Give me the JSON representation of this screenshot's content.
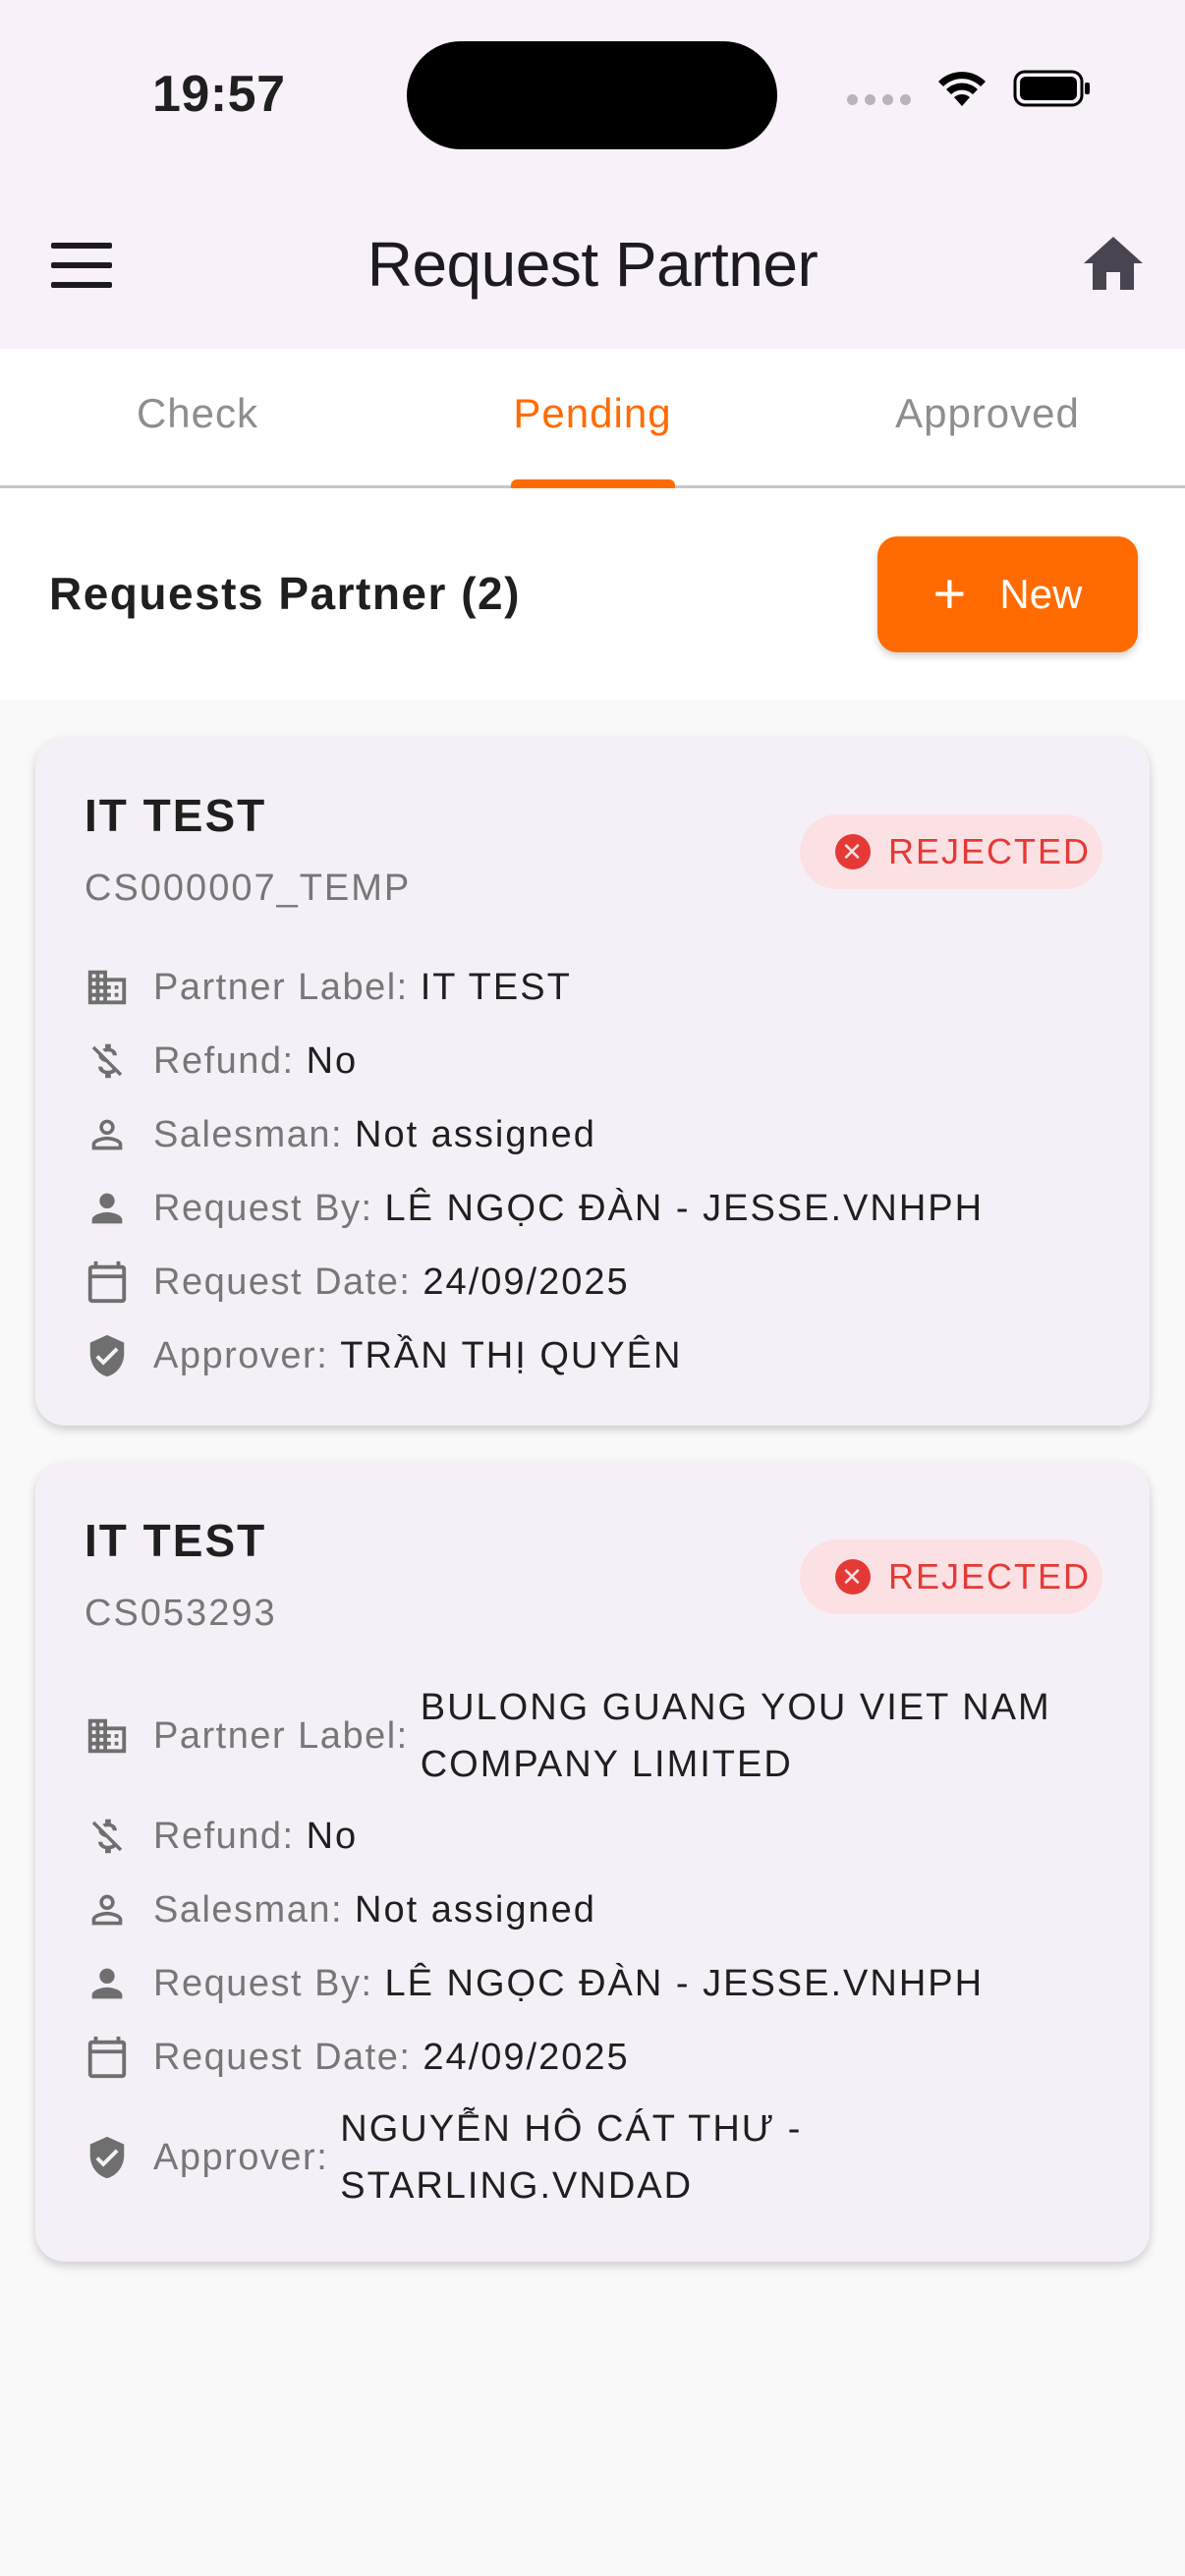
{
  "status_bar": {
    "time": "19:57"
  },
  "app_bar": {
    "title": "Request Partner"
  },
  "tabs": [
    {
      "label": "Check",
      "active": false
    },
    {
      "label": "Pending",
      "active": true
    },
    {
      "label": "Approved",
      "active": false
    }
  ],
  "list": {
    "title": "Requests Partner (2)",
    "new_button": "New"
  },
  "labels": {
    "partner_label": "Partner Label:",
    "refund": "Refund:",
    "salesman": "Salesman:",
    "request_by": "Request By:",
    "request_date": "Request Date:",
    "approver": "Approver:"
  },
  "cards": [
    {
      "title": "IT TEST",
      "code": "CS000007_TEMP",
      "status": "REJECTED",
      "partner_label": "IT TEST",
      "refund": "No",
      "salesman": "Not assigned",
      "request_by": "LÊ NGỌC ĐÀN - JESSE.VNHPH",
      "request_date": "24/09/2025",
      "approver": "TRẦN THỊ QUYÊN"
    },
    {
      "title": "IT TEST",
      "code": "CS053293",
      "status": "REJECTED",
      "partner_label": "BULONG GUANG YOU VIET NAM COMPANY LIMITED",
      "refund": "No",
      "salesman": "Not assigned",
      "request_by": "LÊ NGỌC ĐÀN - JESSE.VNHPH",
      "request_date": "24/09/2025",
      "approver": "NGUYỄN HÔ CÁT THƯ - STARLING.VNDAD"
    }
  ],
  "colors": {
    "accent": "#ff6b00",
    "rejected": "#e53935",
    "rejected_bg": "#fbe1e3",
    "card_bg": "#f5f0f7",
    "app_bar_bg": "#f8f1fa"
  },
  "icons": {
    "menu": "menu-icon",
    "home": "home-icon",
    "partner_label": "building-icon",
    "refund": "money-off-icon",
    "salesman": "person-outline-icon",
    "request_by": "person-icon",
    "request_date": "calendar-icon",
    "approver": "shield-check-icon",
    "status": "x-circle-icon"
  }
}
